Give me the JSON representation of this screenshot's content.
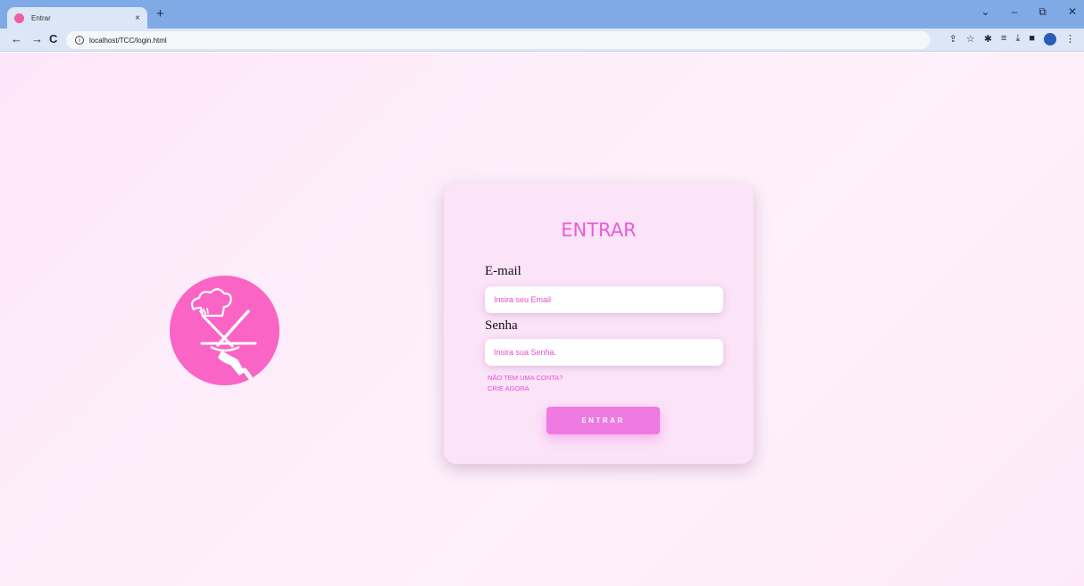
{
  "browser": {
    "tab_title": "Entrar",
    "tab_close": "×",
    "new_tab": "+",
    "url": "localhost/TCC/login.html",
    "window_controls": [
      "⌄",
      "–",
      "⧉",
      "✕"
    ],
    "colors": {
      "tabstrip": "#7faae6",
      "toolbar": "#dbe6f6"
    }
  },
  "page": {
    "title": "ENTRAR",
    "email_label": "E-mail",
    "email_placeholder": "Insira seu Email",
    "password_label": "Senha",
    "password_placeholder": "Insira sua Senha.",
    "no_account_text": "NÃO TEM UMA CONTA?",
    "create_now_link": "CRIE AGORA",
    "submit_label": "ENTRAR",
    "logo_icon": "waiter-tray-chef-hat-icon",
    "colors": {
      "accent": "#e85ed8",
      "logo": "#fa65c5",
      "button": "#ee7ae2",
      "card": "#fbe3f8"
    }
  }
}
